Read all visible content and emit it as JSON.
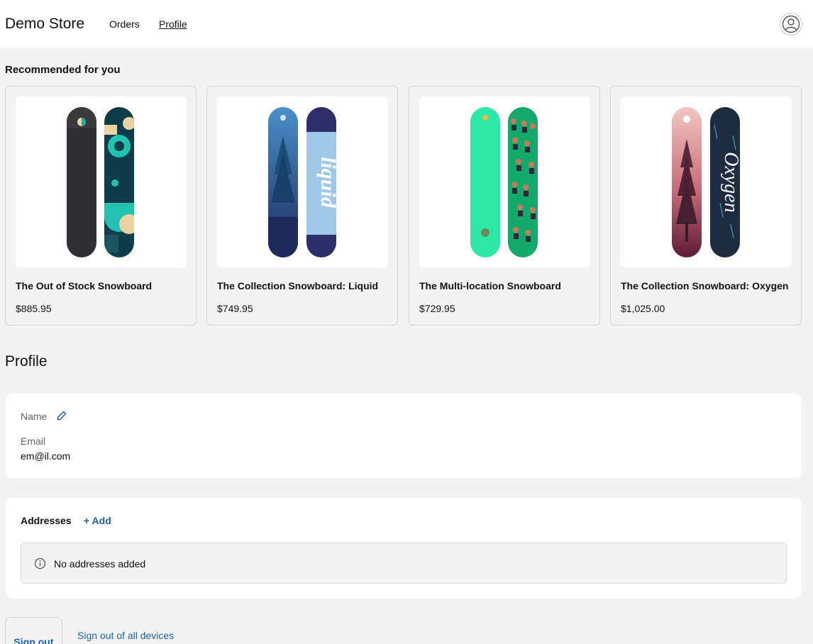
{
  "header": {
    "brand": "Demo Store",
    "nav": {
      "orders": "Orders",
      "profile": "Profile"
    },
    "account_icon": "user-circle-icon"
  },
  "recommended": {
    "title": "Recommended for you",
    "products": [
      {
        "title": "The Out of Stock Snowboard",
        "price": "$885.95"
      },
      {
        "title": "The Collection Snowboard: Liquid",
        "price": "$749.95"
      },
      {
        "title": "The Multi-location Snowboard",
        "price": "$729.95"
      },
      {
        "title": "The Collection Snowboard: Oxygen",
        "price": "$1,025.00"
      }
    ]
  },
  "profile": {
    "heading": "Profile",
    "name_label": "Name",
    "edit_icon": "pencil-icon",
    "email_label": "Email",
    "email_value": "em@il.com"
  },
  "addresses": {
    "label": "Addresses",
    "add_label": "+ Add",
    "empty_message": "No addresses added",
    "info_icon": "info-icon"
  },
  "actions": {
    "sign_out": "Sign out",
    "sign_out_all": "Sign out of all devices"
  },
  "colors": {
    "link": "#1b5fb5",
    "page_bg": "#f3f3f3"
  }
}
